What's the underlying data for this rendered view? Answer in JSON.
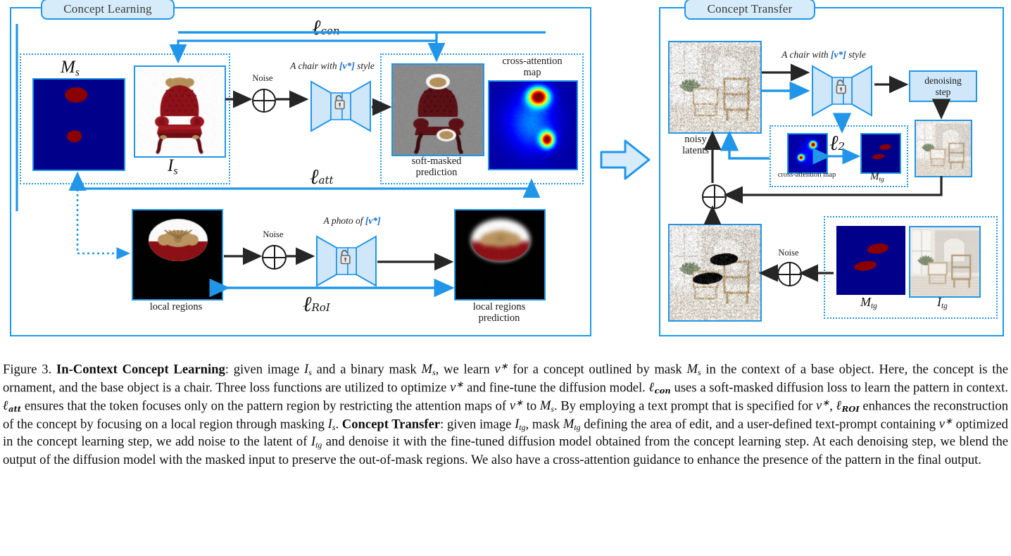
{
  "figure": {
    "panels": [
      {
        "id": "concept-learning",
        "title": "Concept Learning"
      },
      {
        "id": "concept-transfer",
        "title": "Concept Transfer"
      }
    ]
  },
  "concept_learning": {
    "title": "Concept Learning",
    "mask_label": "M_s",
    "mask_label_base": "M",
    "mask_label_sub": "s",
    "source_image_label_base": "I",
    "source_image_label_sub": "s",
    "noise_label": "Noise",
    "prompt_top": {
      "pre": "A chair with ",
      "token": "[v*]",
      "post": " style"
    },
    "prompt_bottom": {
      "pre": "A photo of ",
      "token": "[v*]",
      "post": ""
    },
    "soft_masked_caption": "soft-masked\nprediction",
    "soft_masked_caption_line1": "soft-masked",
    "soft_masked_caption_line2": "prediction",
    "attention_caption_line1": "cross-attention",
    "attention_caption_line2": "map",
    "local_regions_caption": "local regions",
    "local_regions_pred_line1": "local regions",
    "local_regions_pred_line2": "prediction",
    "losses": {
      "con": {
        "symbol": "ℓ",
        "sub": "con"
      },
      "att": {
        "symbol": "ℓ",
        "sub": "att"
      },
      "roi": {
        "symbol": "ℓ",
        "sub": "RoI"
      }
    }
  },
  "concept_transfer": {
    "title": "Concept Transfer",
    "noisy_latents_line1": "noisy",
    "noisy_latents_line2": "latents",
    "prompt": {
      "pre": "A chair with ",
      "token": "[v*]",
      "post": " style"
    },
    "denoising_step_line1": "denoising",
    "denoising_step_line2": "step",
    "attention_caption": "cross-attention map",
    "mask_label_base": "M",
    "mask_label_sub": "tg",
    "target_image_label_base": "I",
    "target_image_label_sub": "tg",
    "noise_label": "Noise",
    "loss": {
      "symbol": "ℓ",
      "sub": "2"
    }
  },
  "caption": {
    "figure_number": "Figure 3.",
    "bold_lead": "In-Context Concept Learning",
    "bold_transfer": "Concept Transfer",
    "text": "Figure 3. In-Context Concept Learning: given image I_s and a binary mask M_s, we learn v* for a concept outlined by mask M_s in the context of a base object. Here, the concept is the ornament, and the base object is a chair. Three loss functions are utilized to optimize v* and fine-tune the diffusion model. ℓ_con uses a soft-masked diffusion loss to learn the pattern in context. ℓ_att ensures that the token focuses only on the pattern region by restricting the attention maps of v* to M_s. By employing a text prompt that is specified for v*, ℓ_ROI enhances the reconstruction of the concept by focusing on a local region through masking I_s. Concept Transfer: given image I_tg, mask M_tg defining the area of edit, and a user-defined text-prompt containing v* optimized in the concept learning step, we add noise to the latent of I_tg and denoise it with the fine-tuned diffusion model obtained from the concept learning step. At each denoising step, we blend the output of the diffusion model with the masked input to preserve the out-of-mask regions. We also have a cross-attention guidance to enhance the presence of the pattern in the final output."
  },
  "colors": {
    "accent_blue": "#2196e8",
    "panel_fill": "#d6ecfa",
    "arrow_black": "#262626",
    "mask_navy": "#00008b",
    "mask_red": "#8b0000",
    "heatmap": "jet"
  }
}
